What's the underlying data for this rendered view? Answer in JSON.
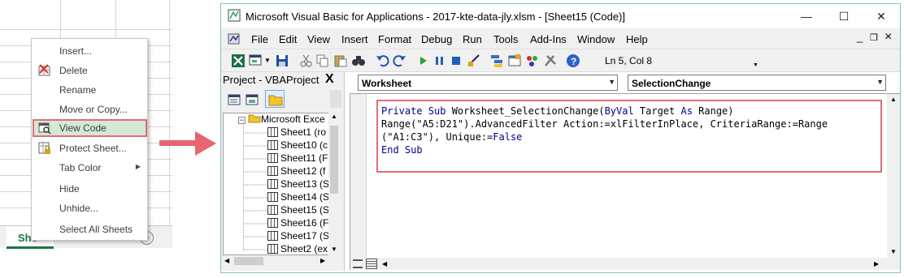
{
  "excel": {
    "sheet_tab_label": "She",
    "add_sheet_symbol": "+",
    "context_menu": [
      {
        "label": "Insert...",
        "icon": null
      },
      {
        "label": "Delete",
        "icon": "delete-sheet-icon"
      },
      {
        "label": "Rename",
        "icon": null
      },
      {
        "label": "Move or Copy...",
        "icon": null
      },
      {
        "label": "View Code",
        "icon": "view-code-icon",
        "highlighted": true
      },
      {
        "label": "Protect Sheet...",
        "icon": "protect-sheet-icon"
      },
      {
        "label": "Tab Color",
        "icon": null,
        "submenu": true
      },
      {
        "label": "Hide",
        "icon": null
      },
      {
        "label": "Unhide...",
        "icon": null
      },
      {
        "label": "Select All Sheets",
        "icon": null
      }
    ]
  },
  "arrow_color": "#e8646f",
  "vbe": {
    "title": "Microsoft Visual Basic for Applications - 2017-kte-data-jly.xlsm - [Sheet15 (Code)]",
    "window_buttons": {
      "minimize": "—",
      "maximize": "☐",
      "close": "✕"
    },
    "menus": [
      "File",
      "Edit",
      "View",
      "Insert",
      "Format",
      "Debug",
      "Run",
      "Tools",
      "Add-Ins",
      "Window",
      "Help"
    ],
    "child_window_buttons": {
      "minimize": "_",
      "restore": "❐",
      "close": "×"
    },
    "toolbar_status": "Ln 5, Col 8",
    "project": {
      "title": "Project - VBAProject",
      "close": "X",
      "folder": "Microsoft Exce",
      "sheets": [
        "Sheet1 (ro",
        "Sheet10 (c",
        "Sheet11 (F",
        "Sheet12 (f",
        "Sheet13 (S",
        "Sheet14 (S",
        "Sheet15 (S",
        "Sheet16 (F",
        "Sheet17 (S",
        "Sheet2 (ex"
      ]
    },
    "object_combo": "Worksheet",
    "procedure_combo": "SelectionChange",
    "code": {
      "line1_kw1": "Private Sub",
      "line1_mid": " Worksheet_SelectionChange(",
      "line1_kw2": "ByVal",
      "line1_mid2": " Target ",
      "line1_kw3": "As",
      "line1_end": " Range)",
      "line2": "Range(\"A5:D21\").AdvancedFilter Action:=xlFilterInPlace, CriteriaRange:=Range",
      "line3_start": "(\"A1:C3\"), Unique:=",
      "line3_kw": "False",
      "line4": "End Sub"
    }
  }
}
